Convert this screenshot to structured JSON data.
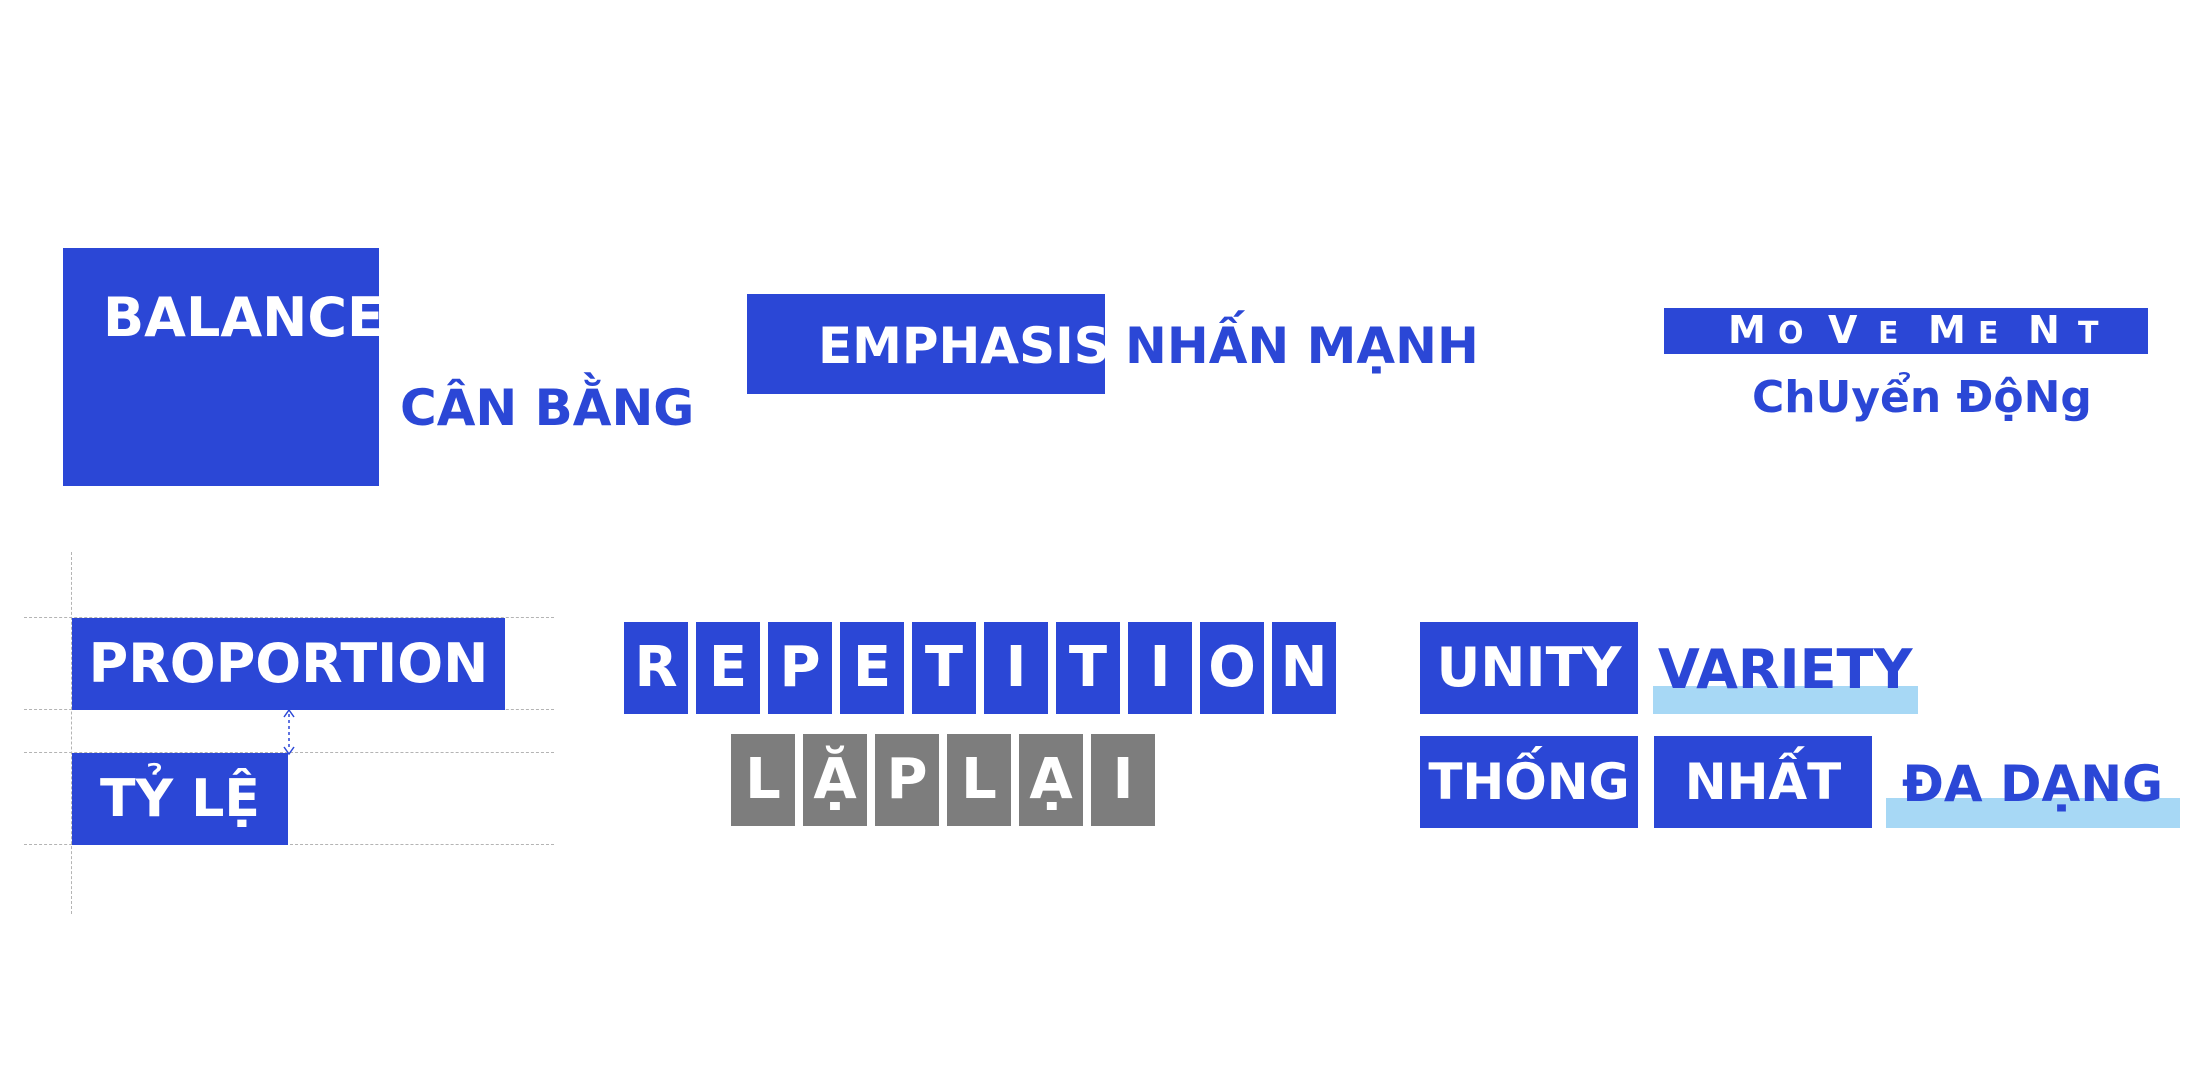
{
  "balance": {
    "label": "BALANCE",
    "translation": "CÂN BẰNG"
  },
  "emphasis": {
    "label": "EMPHASIS",
    "translation": "NHẤN MẠNH"
  },
  "movement": {
    "letters": [
      "M",
      "O",
      "V",
      "E",
      "M",
      "E",
      "N",
      "T"
    ],
    "translation": "ChUyển ĐộNg"
  },
  "proportion": {
    "label": "PROPORTION",
    "translation": "TỶ LỆ"
  },
  "repetition": {
    "letters": [
      "R",
      "E",
      "P",
      "E",
      "T",
      "I",
      "T",
      "I",
      "O",
      "N"
    ],
    "translation_letters": [
      "L",
      "Ặ",
      "P",
      "L",
      "Ạ",
      "I"
    ]
  },
  "unity": {
    "label": "UNITY",
    "variety": "VARIETY",
    "translation_word1": "THỐNG",
    "translation_word2": "NHẤT",
    "variety_translation": "ĐA DẠNG"
  },
  "colors": {
    "primary_blue": "#2b47d6",
    "light_blue": "#a7d8f5",
    "gray": "#7d7d7d",
    "guide": "#b4b4b4"
  }
}
